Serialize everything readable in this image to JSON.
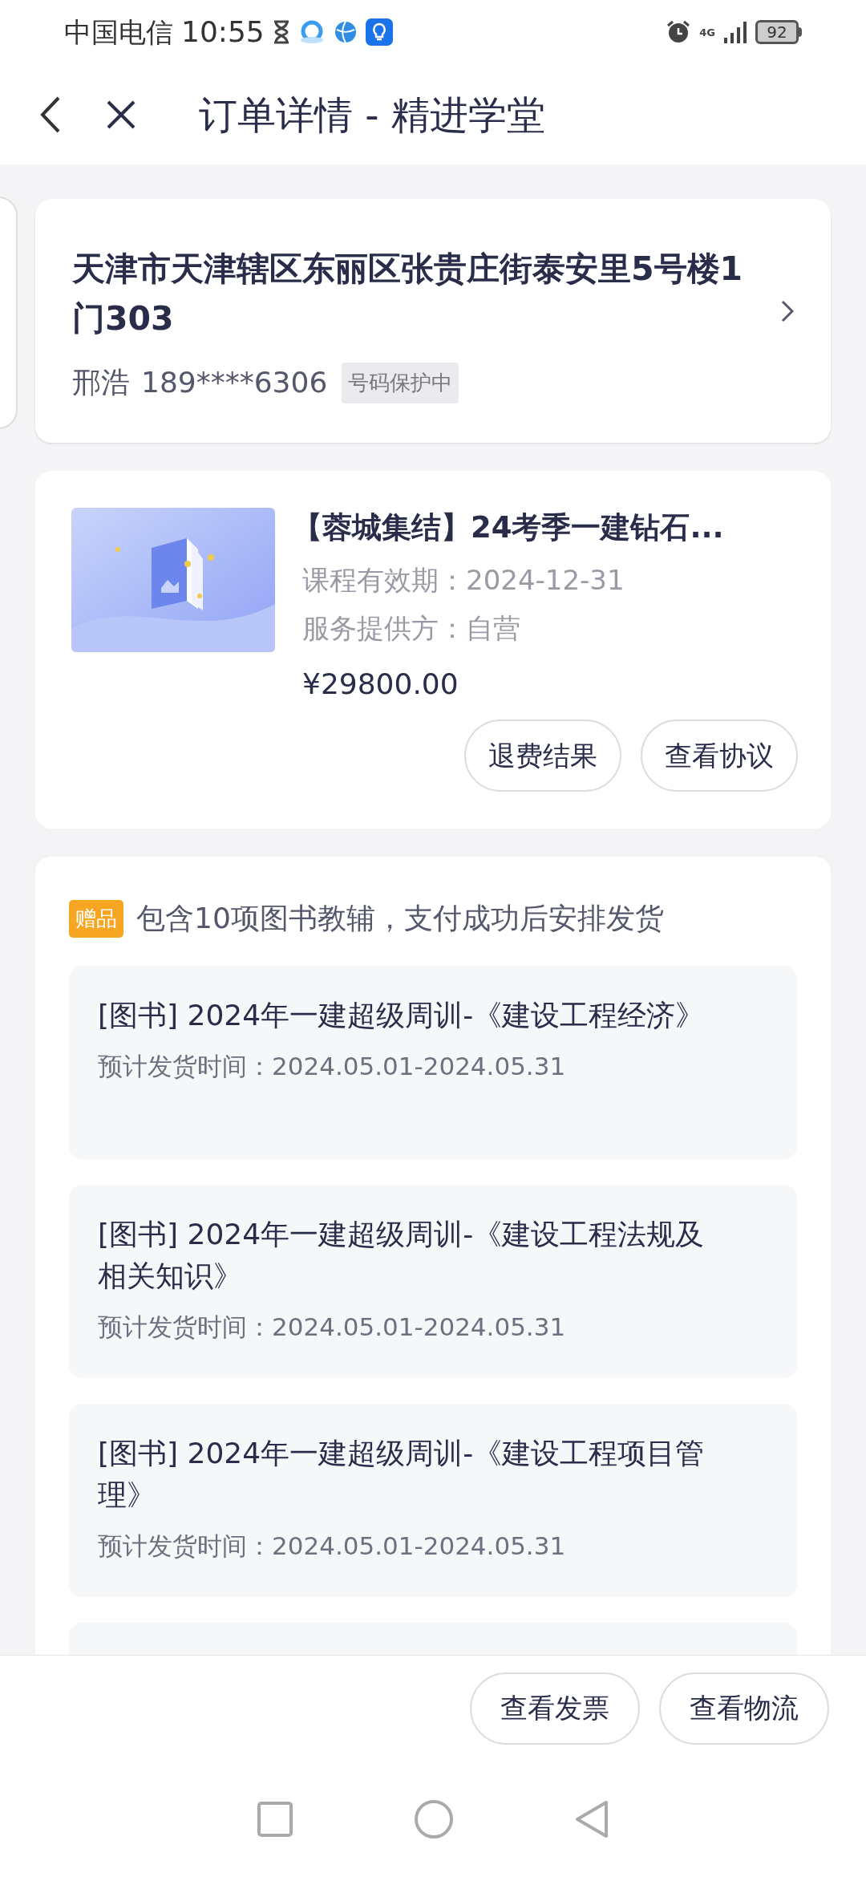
{
  "status_bar": {
    "carrier": "中国电信",
    "time": "10:55",
    "network": "4G",
    "battery": "92"
  },
  "header": {
    "title": "订单详情 - 精进学堂"
  },
  "address": {
    "text": "天津市天津辖区东丽区张贵庄街泰安里5号楼1门303",
    "name": "邢浩",
    "phone": "189****6306",
    "badge": "号码保护中"
  },
  "product": {
    "image": {
      "kind": "picture"
    },
    "title": "【蓉城集结】24考季一建钻石...",
    "validity_label": "课程有效期：",
    "validity": "2024-12-31",
    "provider_label": "服务提供方：",
    "provider": "自营",
    "price": "¥29800.00",
    "buttons": [
      "退费结果",
      "查看协议"
    ]
  },
  "gifts": {
    "tag": "赠品",
    "summary": "包含10项图书教辅，支付成功后安排发货",
    "items": [
      {
        "title": "[图书]  2024年一建超级周训-《建设工程经济》",
        "ship_label": "预计发货时间：",
        "ship_time": "2024.05.01-2024.05.31"
      },
      {
        "title": "[图书]  2024年一建超级周训-《建设工程法规及相关知识》",
        "ship_label": "预计发货时间：",
        "ship_time": "2024.05.01-2024.05.31"
      },
      {
        "title": "[图书]  2024年一建超级周训-《建设工程项目管理》",
        "ship_label": "预计发货时间：",
        "ship_time": "2024.05.01-2024.05.31"
      }
    ]
  },
  "bottom_buttons": [
    "查看发票",
    "查看物流"
  ]
}
